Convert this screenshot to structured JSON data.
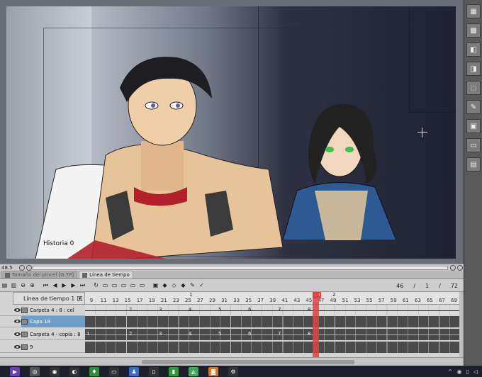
{
  "canvas": {
    "history_label": "Historia 0",
    "zoom": "48.5"
  },
  "tabs": [
    {
      "label": "Tamaño del pincel [G TP]",
      "active": false
    },
    {
      "label": "Línea de tiempo",
      "active": true
    }
  ],
  "timeline": {
    "name": "Línea de tiempo 1",
    "frame_current": "46",
    "frame_sep1": "/",
    "frame_start": "1",
    "frame_sep2": "/",
    "frame_total": "72",
    "ruler_marks": [
      "9",
      "11",
      "13",
      "15",
      "17",
      "19",
      "21",
      "23",
      "25",
      "27",
      "29",
      "31",
      "33",
      "35",
      "37",
      "39",
      "41",
      "43",
      "45",
      "47",
      "49",
      "51",
      "53",
      "55",
      "57",
      "59",
      "61",
      "63",
      "65",
      "67",
      "69"
    ],
    "ruler_sub_1": "1",
    "ruler_sub_2": "2",
    "playhead_label": "46",
    "layers": [
      {
        "name": "Carpeta 4 : 8 : cel",
        "cells": [
          "2",
          "3",
          "4",
          "5",
          "6",
          "7",
          "8"
        ],
        "style": "light",
        "eye": false,
        "selected": false
      },
      {
        "name": "Capa 18",
        "cells": [],
        "style": "dark",
        "eye": true,
        "selected": true
      },
      {
        "name": "Carpeta 4 - copia : 8",
        "cells": [
          "1",
          "2",
          "3",
          "4",
          "5",
          "6",
          "7",
          "8"
        ],
        "style": "dark",
        "eye": true,
        "selected": false
      },
      {
        "name": "9",
        "cells": [],
        "style": "dark",
        "eye": true,
        "selected": false
      }
    ]
  },
  "colors": {
    "playhead": "#e04848",
    "selection": "#6e9ec9"
  }
}
